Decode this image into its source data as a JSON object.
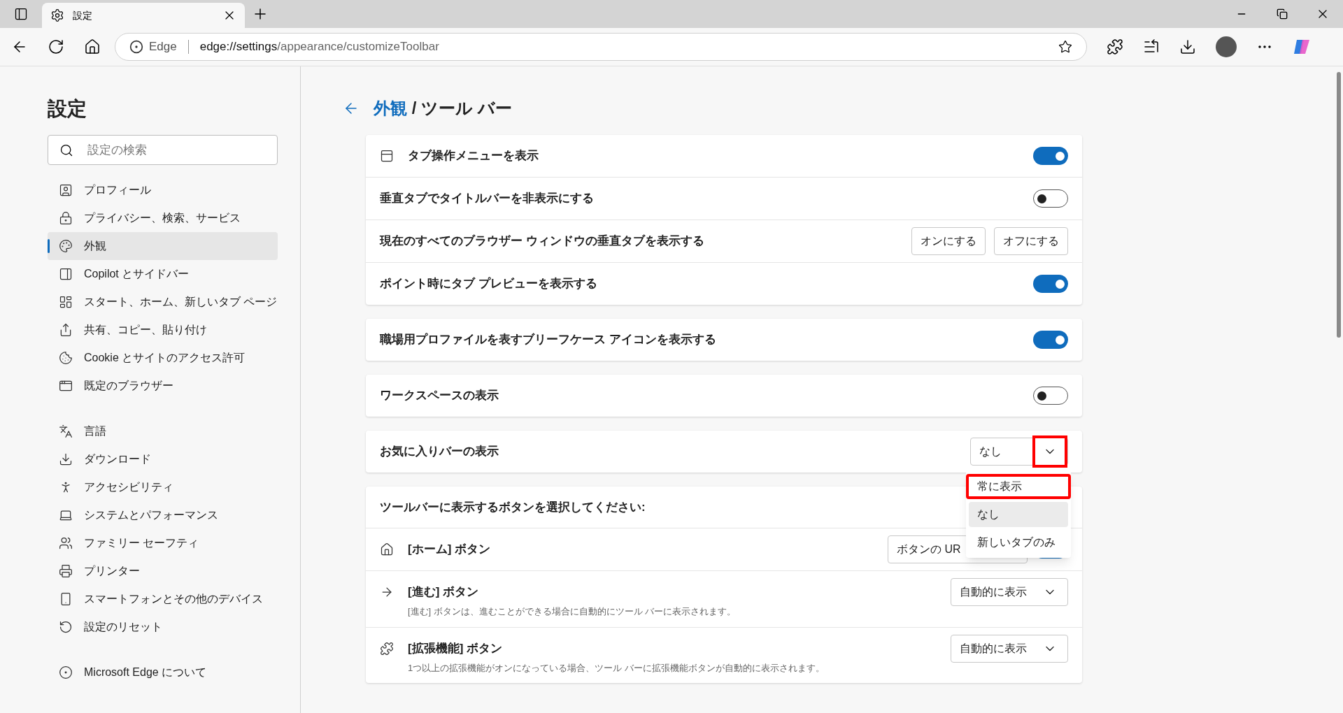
{
  "tab": {
    "title": "設定",
    "selected": true
  },
  "address": {
    "site": "Edge",
    "url_host": "edge://settings",
    "url_path": "/appearance/customizeToolbar"
  },
  "sidebar": {
    "title": "設定",
    "search": {
      "placeholder": "設定の検索"
    },
    "groups": [
      [
        {
          "label": "プロフィール",
          "selected": false
        },
        {
          "label": "プライバシー、検索、サービス",
          "selected": false
        },
        {
          "label": "外観",
          "selected": true
        },
        {
          "label": "Copilot とサイドバー",
          "selected": false
        },
        {
          "label": "スタート、ホーム、新しいタブ ページ",
          "selected": false
        },
        {
          "label": "共有、コピー、貼り付け",
          "selected": false
        },
        {
          "label": "Cookie とサイトのアクセス許可",
          "selected": false
        },
        {
          "label": "既定のブラウザー",
          "selected": false
        }
      ],
      [
        {
          "label": "言語",
          "selected": false
        },
        {
          "label": "ダウンロード",
          "selected": false
        },
        {
          "label": "アクセシビリティ",
          "selected": false
        },
        {
          "label": "システムとパフォーマンス",
          "selected": false
        },
        {
          "label": "ファミリー セーフティ",
          "selected": false
        },
        {
          "label": "プリンター",
          "selected": false
        },
        {
          "label": "スマートフォンとその他のデバイス",
          "selected": false
        },
        {
          "label": "設定のリセット",
          "selected": false
        }
      ],
      [
        {
          "label": "Microsoft Edge について",
          "selected": false
        }
      ]
    ]
  },
  "breadcrumb": {
    "parent": "外観",
    "separator": "/",
    "current": "ツール バー"
  },
  "cards": [
    {
      "rows": [
        {
          "kind": "toggle",
          "label": "タブ操作メニューを表示",
          "on": true
        },
        {
          "kind": "toggle",
          "label": "垂直タブでタイトルバーを非表示にする",
          "on": false
        },
        {
          "kind": "buttons",
          "label": "現在のすべてのブラウザー ウィンドウの垂直タブを表示する",
          "buttons": [
            "オンにする",
            "オフにする"
          ]
        },
        {
          "kind": "toggle",
          "label": "ポイント時にタブ プレビューを表示する",
          "on": true
        }
      ]
    },
    {
      "rows": [
        {
          "kind": "toggle",
          "label": "職場用プロファイルを表すブリーフケース アイコンを表示する",
          "on": true
        }
      ]
    },
    {
      "rows": [
        {
          "kind": "toggle",
          "label": "ワークスペースの表示",
          "on": false
        }
      ]
    },
    {
      "rows": [
        {
          "kind": "select",
          "label": "お気に入りバーの表示",
          "value": "なし",
          "highlighted": true,
          "menu": [
            {
              "label": "常に表示",
              "selected": false,
              "highlighted": true
            },
            {
              "label": "なし",
              "selected": true,
              "highlighted": false
            },
            {
              "label": "新しいタブのみ",
              "selected": false,
              "highlighted": false
            }
          ]
        }
      ]
    },
    {
      "header": "ツールバーに表示するボタンを選択してください:",
      "rows": [
        {
          "kind": "button_toggle",
          "label": "[ホーム] ボタン",
          "button": "ボタンの UR",
          "on": true
        },
        {
          "kind": "select",
          "label": "[進む] ボタン",
          "value": "自動的に表示",
          "description": "[進む] ボタンは、進むことができる場合に自動的にツール バーに表示されます。"
        },
        {
          "kind": "select",
          "label": "[拡張機能] ボタン",
          "value": "自動的に表示",
          "description": "1つ以上の拡張機能がオンになっている場合、ツール バーに拡張機能ボタンが自動的に表示されます。"
        }
      ]
    }
  ]
}
